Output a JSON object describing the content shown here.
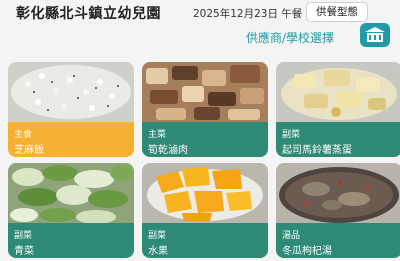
{
  "header": {
    "school_name": "彰化縣北斗鎮立幼兒園",
    "date_meal": "2025年12月23日 午餐",
    "meal_type_button": "供餐型態",
    "supplier_school_link": "供應商/學校選擇",
    "school_icon": "school-icon"
  },
  "colors": {
    "accent": "#1f9aa6",
    "card_label": "#2e8a74",
    "selected_label": "#f7b031"
  },
  "dishes": [
    {
      "category": "主食",
      "name": "芝麻飯",
      "selected": true
    },
    {
      "category": "主菜",
      "name": "筍乾滷肉",
      "selected": false
    },
    {
      "category": "副菜",
      "name": "起司馬鈴薯蒸蛋",
      "selected": false
    },
    {
      "category": "副菜",
      "name": "青菜",
      "selected": false
    },
    {
      "category": "副菜",
      "name": "水果",
      "selected": false
    },
    {
      "category": "湯品",
      "name": "冬瓜枸杞湯",
      "selected": false
    }
  ]
}
